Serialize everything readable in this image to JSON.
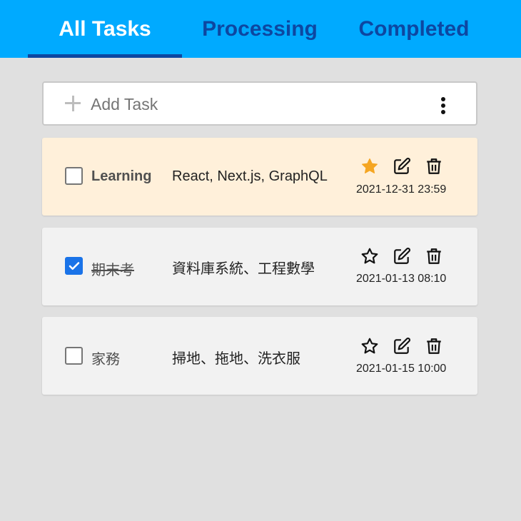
{
  "tabs": [
    {
      "label": "All Tasks",
      "active": true
    },
    {
      "label": "Processing",
      "active": false
    },
    {
      "label": "Completed",
      "active": false
    }
  ],
  "add_task": {
    "placeholder": "Add Task",
    "plus_icon": "plus-icon",
    "menu_icon": "more-vert-icon"
  },
  "tasks": [
    {
      "title": "Learning",
      "description": "React, Next.js, GraphQL",
      "date": "2021-12-31 23:59",
      "checked": false,
      "starred": true
    },
    {
      "title": "期末考",
      "description": "資料庫系統、工程數學",
      "date": "2021-01-13 08:10",
      "checked": true,
      "starred": false
    },
    {
      "title": "家務",
      "description": "掃地、拖地、洗衣服",
      "date": "2021-01-15 10:00",
      "checked": false,
      "starred": false
    }
  ],
  "colors": {
    "tabbar_bg": "#00aaff",
    "tab_inactive": "#0d47a1",
    "tab_active": "#ffffff",
    "starred_card_bg": "#fff0da",
    "card_bg": "#f2f2f2",
    "star_filled": "#f5a623",
    "checkbox_checked": "#1a73e8",
    "page_bg": "#e0e0e0"
  }
}
